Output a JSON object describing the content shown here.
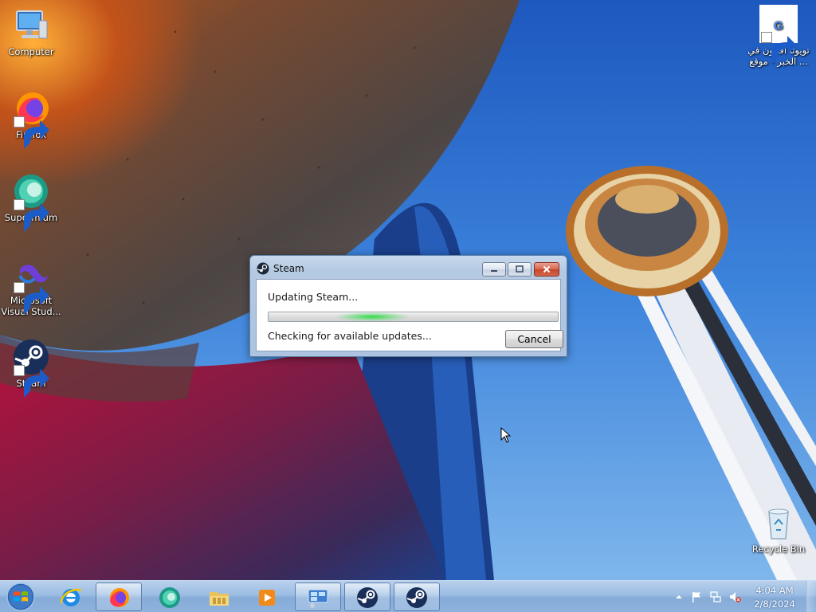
{
  "desktop": {
    "icons": [
      {
        "label_line1": "Computer",
        "label_line2": ""
      },
      {
        "label_line1": "Firefox",
        "label_line2": ""
      },
      {
        "label_line1": "Supermium",
        "label_line2": ""
      },
      {
        "label_line1": "Microsoft",
        "label_line2": "Visual Stud..."
      },
      {
        "label_line1": "Steam",
        "label_line2": ""
      }
    ],
    "google_shortcut": {
      "label_line1": "تويوتا افالون في",
      "label_line2": "... الخبر - موقع",
      "glyph": "G"
    },
    "recycle_bin": {
      "label": "Recycle Bin"
    }
  },
  "steam_dialog": {
    "title": "Steam",
    "heading": "Updating Steam...",
    "status": "Checking for available updates...",
    "cancel_label": "Cancel",
    "progress_mode": "indeterminate"
  },
  "taskbar": {
    "pinned": [
      "internet-explorer",
      "firefox",
      "supermium",
      "file-explorer",
      "media-player",
      "remote-desktop",
      "steam",
      "steam"
    ],
    "clock": {
      "time": "4:04 AM",
      "date": "2/8/2024"
    }
  },
  "colors": {
    "taskbar": "#86abd7",
    "steam_blue": "#1b2838",
    "progress_green": "#28dc3c",
    "close_red": "#c6452d"
  }
}
